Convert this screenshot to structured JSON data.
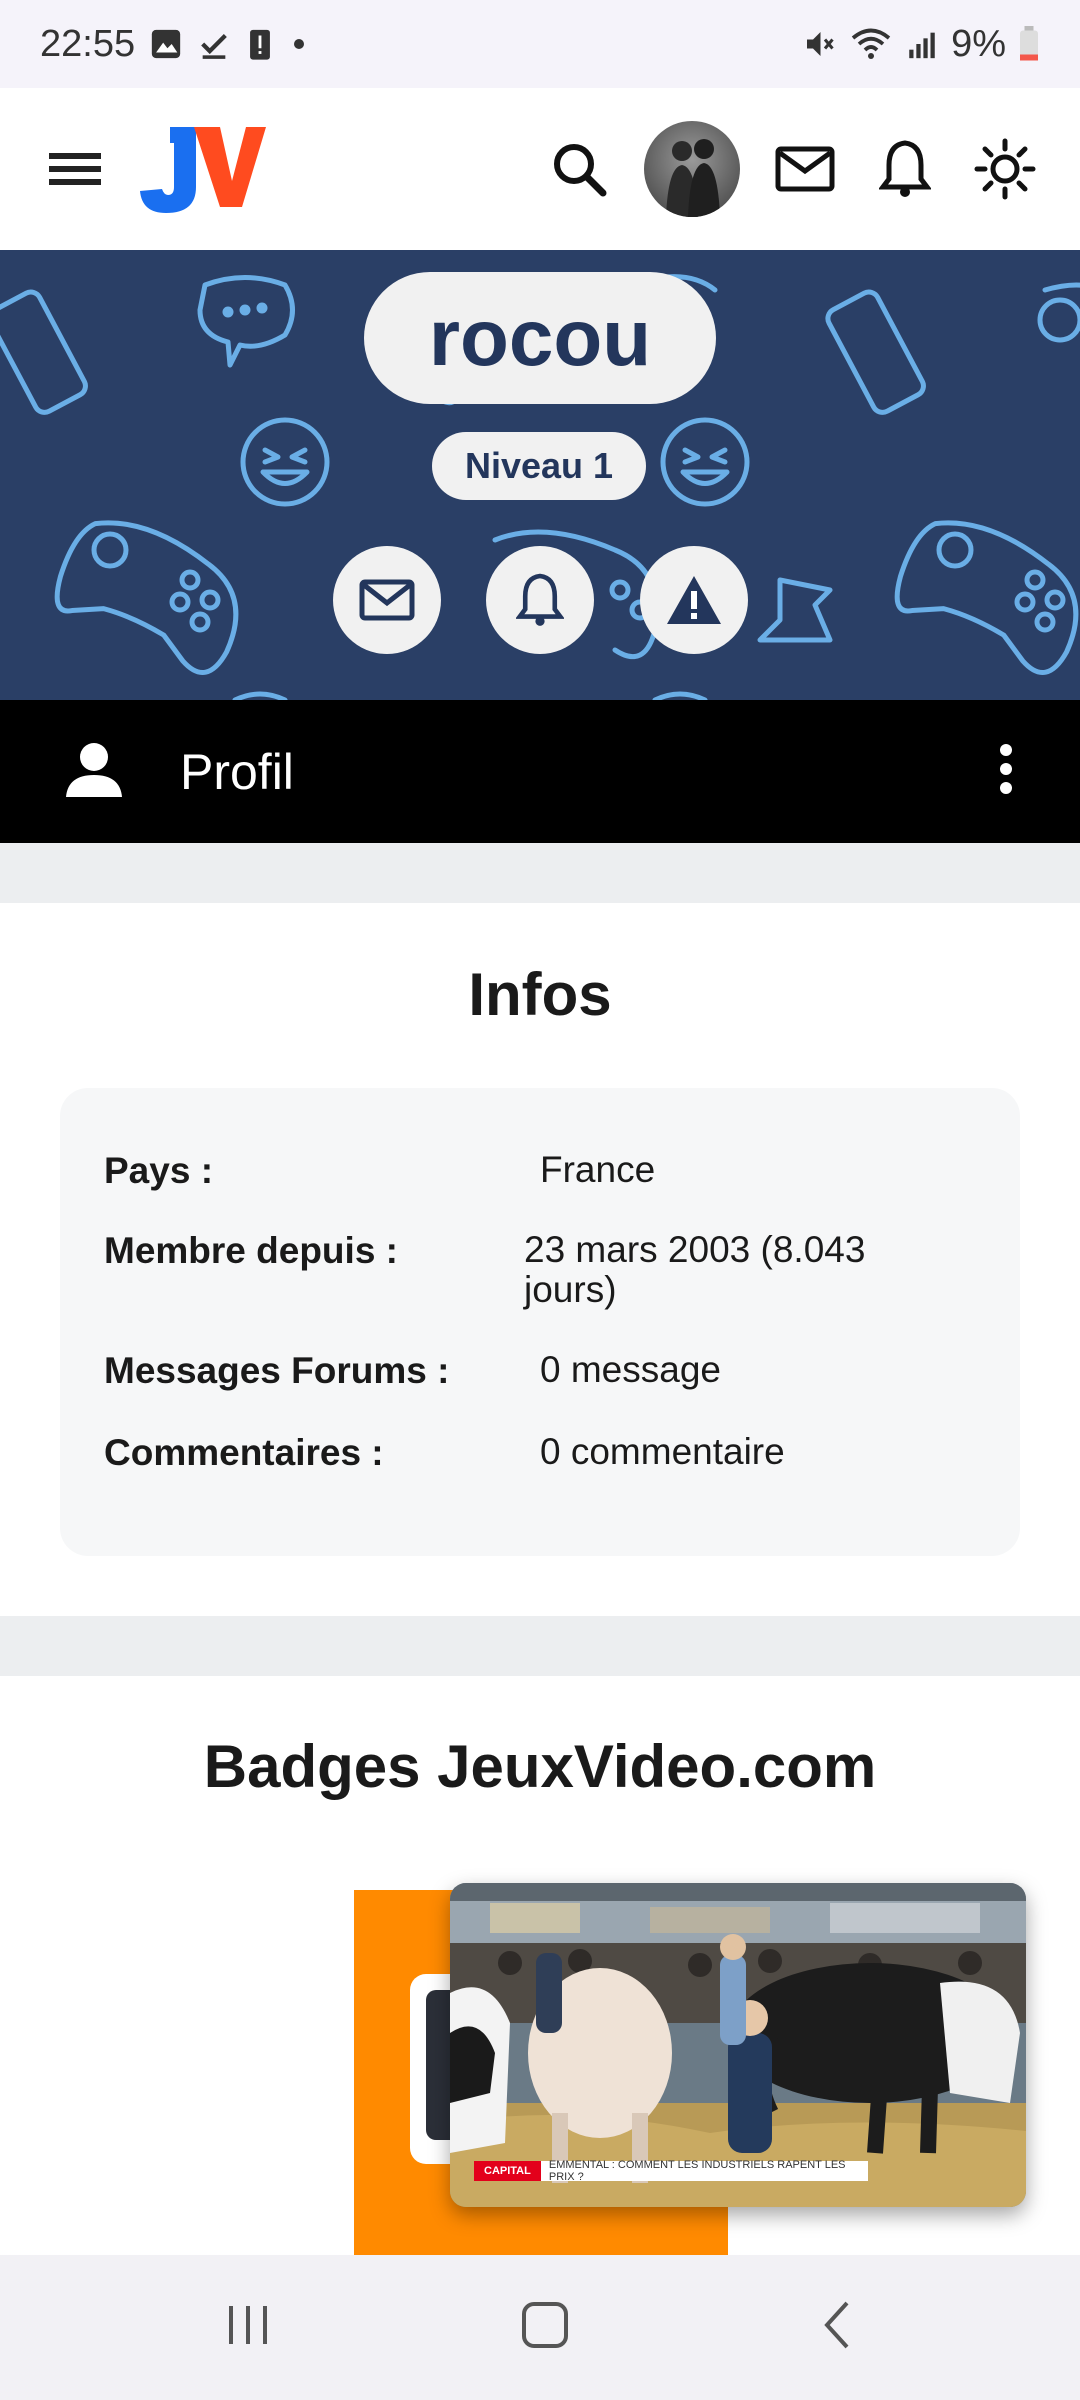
{
  "status_bar": {
    "time": "22:55",
    "battery": "9%"
  },
  "header": {
    "logo": "JV"
  },
  "banner": {
    "username": "rocou",
    "level": "Niveau 1"
  },
  "profile_bar": {
    "label": "Profil"
  },
  "infos": {
    "title": "Infos",
    "rows": [
      {
        "key": "Pays :",
        "value": "France"
      },
      {
        "key": "Membre depuis :",
        "value": "23 mars 2003 (8.043 jours)"
      },
      {
        "key": "Messages Forums :",
        "value": "0 message"
      },
      {
        "key": "Commentaires :",
        "value": "0 commentaire"
      }
    ]
  },
  "badges": {
    "title": "Badges JeuxVideo.com"
  },
  "video": {
    "brand": "CAPITAL",
    "ticker": "EMMENTAL : COMMENT LES INDUSTRIELS RAPENT LES PRIX ?"
  },
  "icons": {
    "menu": "hamburger-icon",
    "search": "search-icon",
    "mail": "mail-icon",
    "bell": "bell-icon",
    "theme": "sun-icon",
    "report": "warning-icon",
    "profile": "person-icon",
    "more": "more-vertical-icon"
  },
  "colors": {
    "banner_bg": "#2a3f66",
    "banner_pattern": "#6aaee6",
    "pill_text": "#23365c",
    "badge_orange": "#ff8a00",
    "logo_blue": "#1a6ff0",
    "logo_orange": "#ff4b1f"
  }
}
